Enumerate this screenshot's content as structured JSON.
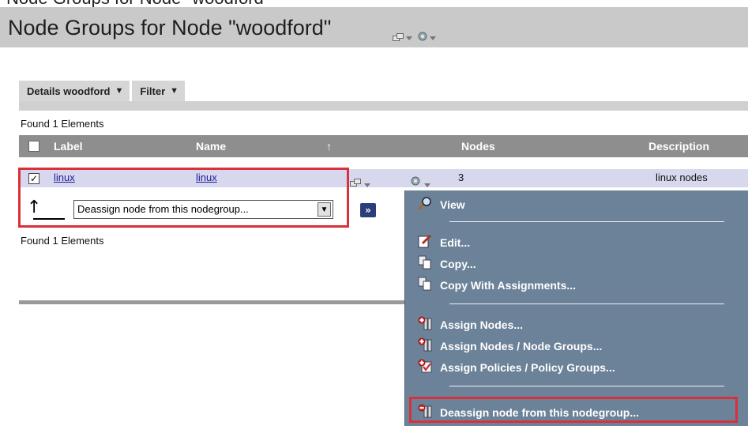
{
  "page": {
    "cut_title": "Node Groups for Node \"woodford\"",
    "title": "Node Groups for Node \"woodford\""
  },
  "tabs": [
    {
      "label": "Details woodford",
      "caret": "▼"
    },
    {
      "label": "Filter",
      "caret": "▼"
    }
  ],
  "found_text_top": "Found 1 Elements",
  "found_text_bottom": "Found 1 Elements",
  "table": {
    "headers": {
      "label": "Label",
      "name": "Name",
      "sort_arrow": "↑",
      "nodes": "Nodes",
      "description": "Description"
    },
    "rows": [
      {
        "checked": true,
        "check_mark": "✓",
        "label": "linux",
        "name": "linux",
        "nodes": "3",
        "description": "linux nodes"
      }
    ]
  },
  "action": {
    "up_arrow": "↑",
    "selected": "Deassign node from this nodegroup...",
    "go_label": "»"
  },
  "menu": {
    "items": [
      {
        "label": "View",
        "icon": "magnifier-icon"
      },
      {
        "label": "Edit...",
        "icon": "edit-icon"
      },
      {
        "label": "Copy...",
        "icon": "copy-icon"
      },
      {
        "label": "Copy With Assignments...",
        "icon": "copy-icon"
      },
      {
        "label": "Assign Nodes...",
        "icon": "assign-nodes-icon"
      },
      {
        "label": "Assign Nodes / Node Groups...",
        "icon": "assign-nodes-icon"
      },
      {
        "label": "Assign Policies / Policy Groups...",
        "icon": "assign-policy-icon"
      },
      {
        "label": "Deassign node from this nodegroup...",
        "icon": "deassign-icon"
      }
    ]
  },
  "colors": {
    "title_bar": "#c9c9c9",
    "table_header": "#8e8e8e",
    "row_highlight": "#d7d7ee",
    "menu_bg": "#6b8299",
    "highlight_red": "#d9303a",
    "link": "#1a1a99"
  }
}
